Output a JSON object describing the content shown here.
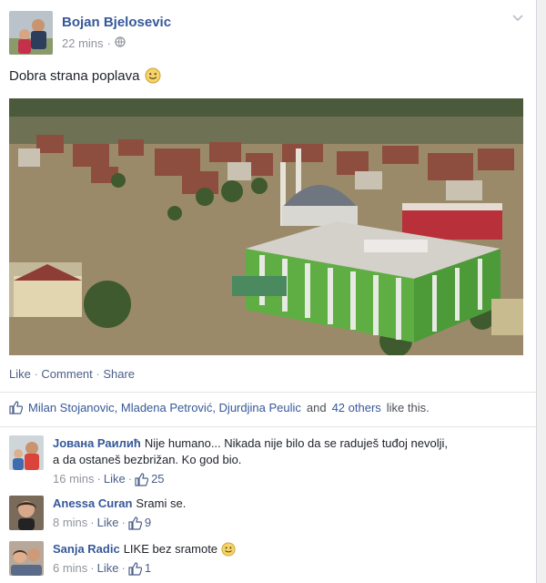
{
  "post": {
    "author": "Bojan Bjelosevic",
    "time": "22 mins",
    "separator": "·",
    "text": "Dobra strana poplava",
    "actions": [
      "Like",
      "Comment",
      "Share"
    ]
  },
  "likes_summary": {
    "names": "Milan Stojanovic, Mladena Petrović, Djurdjina Peulic",
    "connector": "and",
    "others": "42 others",
    "suffix": "like this."
  },
  "comments": [
    {
      "author": "Јована Раилић",
      "text_line1": "Nije humano... Nikada nije bilo da se raduješ tuđoj nevolji,",
      "text_line2": "a da ostaneš bezbrižan. Ko god bio.",
      "time": "16 mins",
      "like": "Like",
      "count": "25"
    },
    {
      "author": "Anessa Curan",
      "text_line1": "Srami se.",
      "time": "8 mins",
      "like": "Like",
      "count": "9"
    },
    {
      "author": "Sanja Radic",
      "text_line1": "LIKE bez sramote",
      "time": "6 mins",
      "like": "Like",
      "count": "1"
    }
  ],
  "colors": {
    "link": "#365899",
    "muted": "#90949c",
    "water": "#9b8a6a"
  },
  "icons": [
    "globe-icon",
    "chevron-down-icon",
    "smiley-icon",
    "thumbs-up-icon"
  ]
}
